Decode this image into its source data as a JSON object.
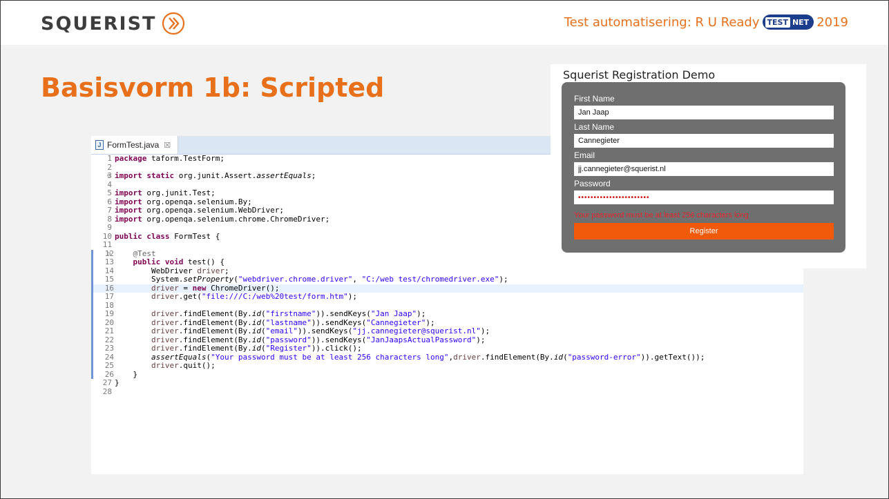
{
  "header": {
    "logo_text": "SQUERIST",
    "event_prefix": "Test automatisering: R U Ready",
    "badge_left": "TEST",
    "badge_right": "NET",
    "event_year": "2019",
    "accent_color": "#e8701a"
  },
  "slide": {
    "title": "Basisvorm 1b: Scripted"
  },
  "ide": {
    "tab_label": "FormTest.java",
    "tab_close": "☒",
    "tab_icon": "J"
  },
  "registration": {
    "title": "Squerist Registration Demo",
    "first_name_label": "First Name",
    "first_name_value": "Jan Jaap",
    "last_name_label": "Last Name",
    "last_name_value": "Cannegieter",
    "email_label": "Email",
    "email_value": "jj.cannegieter@squerist.nl",
    "password_label": "Password",
    "password_value": "•••••••••••••••••••••••",
    "error_text": "Your password must be at least 256 characters long",
    "register_label": "Register"
  }
}
